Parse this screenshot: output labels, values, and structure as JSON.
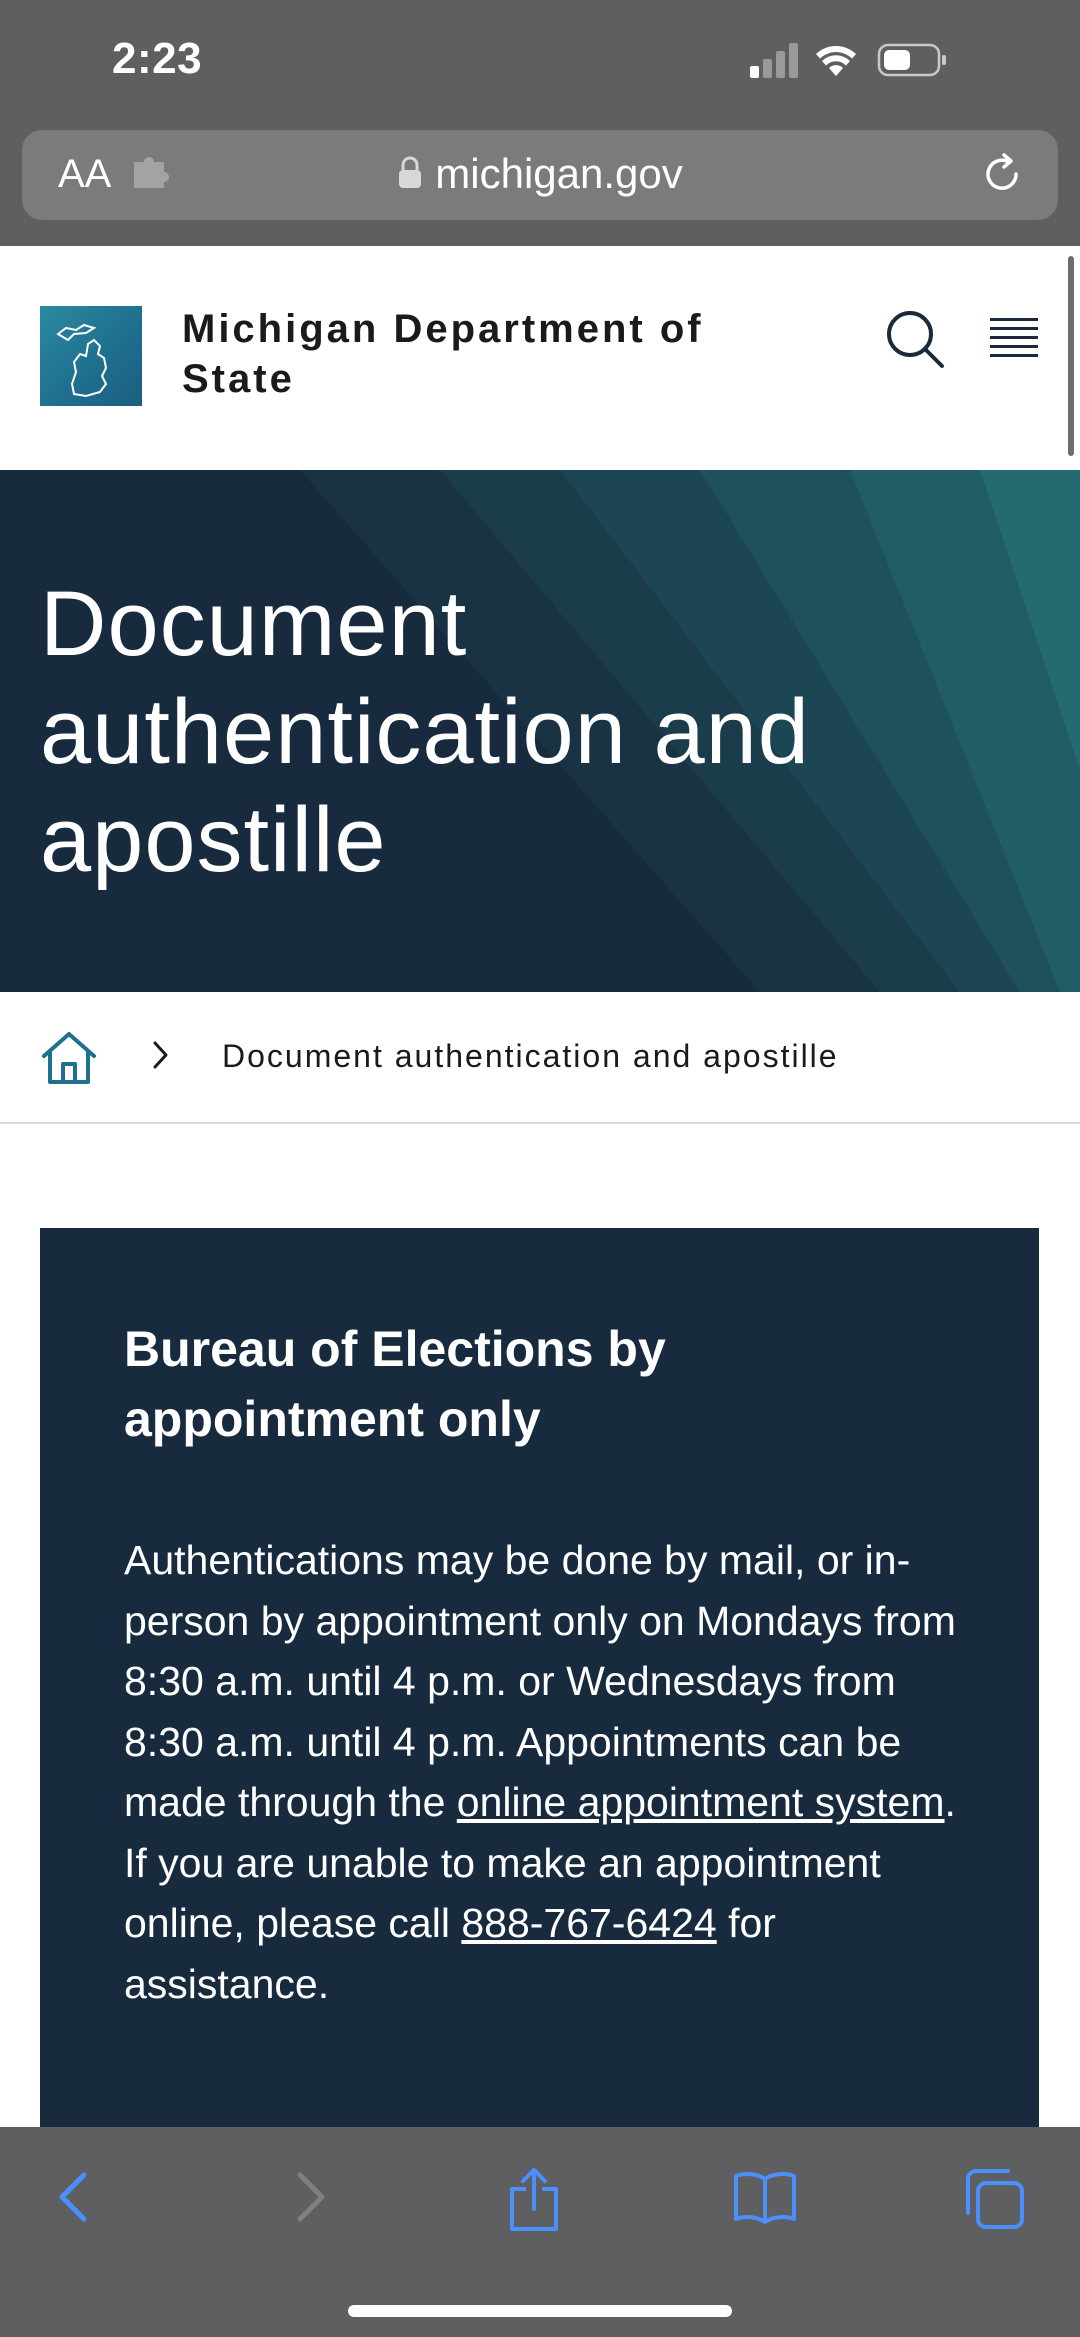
{
  "status_bar": {
    "time": "2:23"
  },
  "browser": {
    "text_size_label": "AA",
    "url": "michigan.gov"
  },
  "site": {
    "title": "Michigan Department of State"
  },
  "hero": {
    "title": "Document authentication and apostille"
  },
  "breadcrumb": {
    "current": "Document authentication and apostille"
  },
  "notice": {
    "heading": "Bureau of Elections by appointment only",
    "body_before_link": "Authentications may be done by mail, or in-person by appointment only on Mondays from 8:30 a.m. until 4 p.m. or Wednesdays from 8:30 a.m. until 4 p.m. Appointments can be made through the ",
    "link_text": "online appointment system",
    "body_middle": ". If you are unable to make an appointment online, please call ",
    "phone": "888-767-6424",
    "body_after": " for assistance."
  },
  "colors": {
    "navy": "#172a3e",
    "teal": "#1f6f8f",
    "browser_chrome": "#5f5f61",
    "ios_blue": "#4a90ff"
  },
  "icons": [
    "signal-icon",
    "wifi-icon",
    "battery-icon",
    "extension-icon",
    "lock-icon",
    "reload-icon",
    "michigan-logo-icon",
    "search-icon",
    "menu-icon",
    "home-icon",
    "chevron-right-icon",
    "back-icon",
    "forward-icon",
    "share-icon",
    "bookmarks-icon",
    "tabs-icon"
  ]
}
